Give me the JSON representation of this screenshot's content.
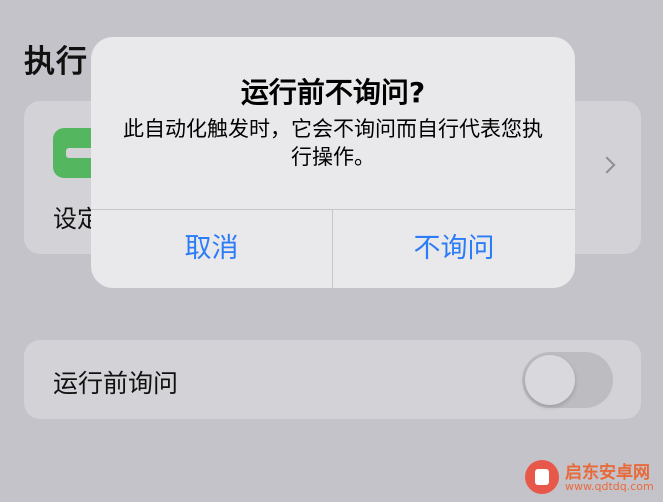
{
  "background": {
    "section_title": "执行",
    "action_label": "设定",
    "ask_label": "运行前询问",
    "ask_toggle_on": false
  },
  "alert": {
    "title": "运行前不询问?",
    "message": "此自动化触发时，它会不询问而自行代表您执行操作。",
    "cancel_label": "取消",
    "confirm_label": "不询问"
  },
  "watermark": {
    "name": "启东安卓网",
    "url": "www.qdtdq.com"
  },
  "colors": {
    "accent": "#2b7cf6",
    "shortcut_icon": "#55b660"
  },
  "icons": [
    "shortcut-icon",
    "chevron-right-icon",
    "toggle-switch",
    "watermark-logo"
  ]
}
